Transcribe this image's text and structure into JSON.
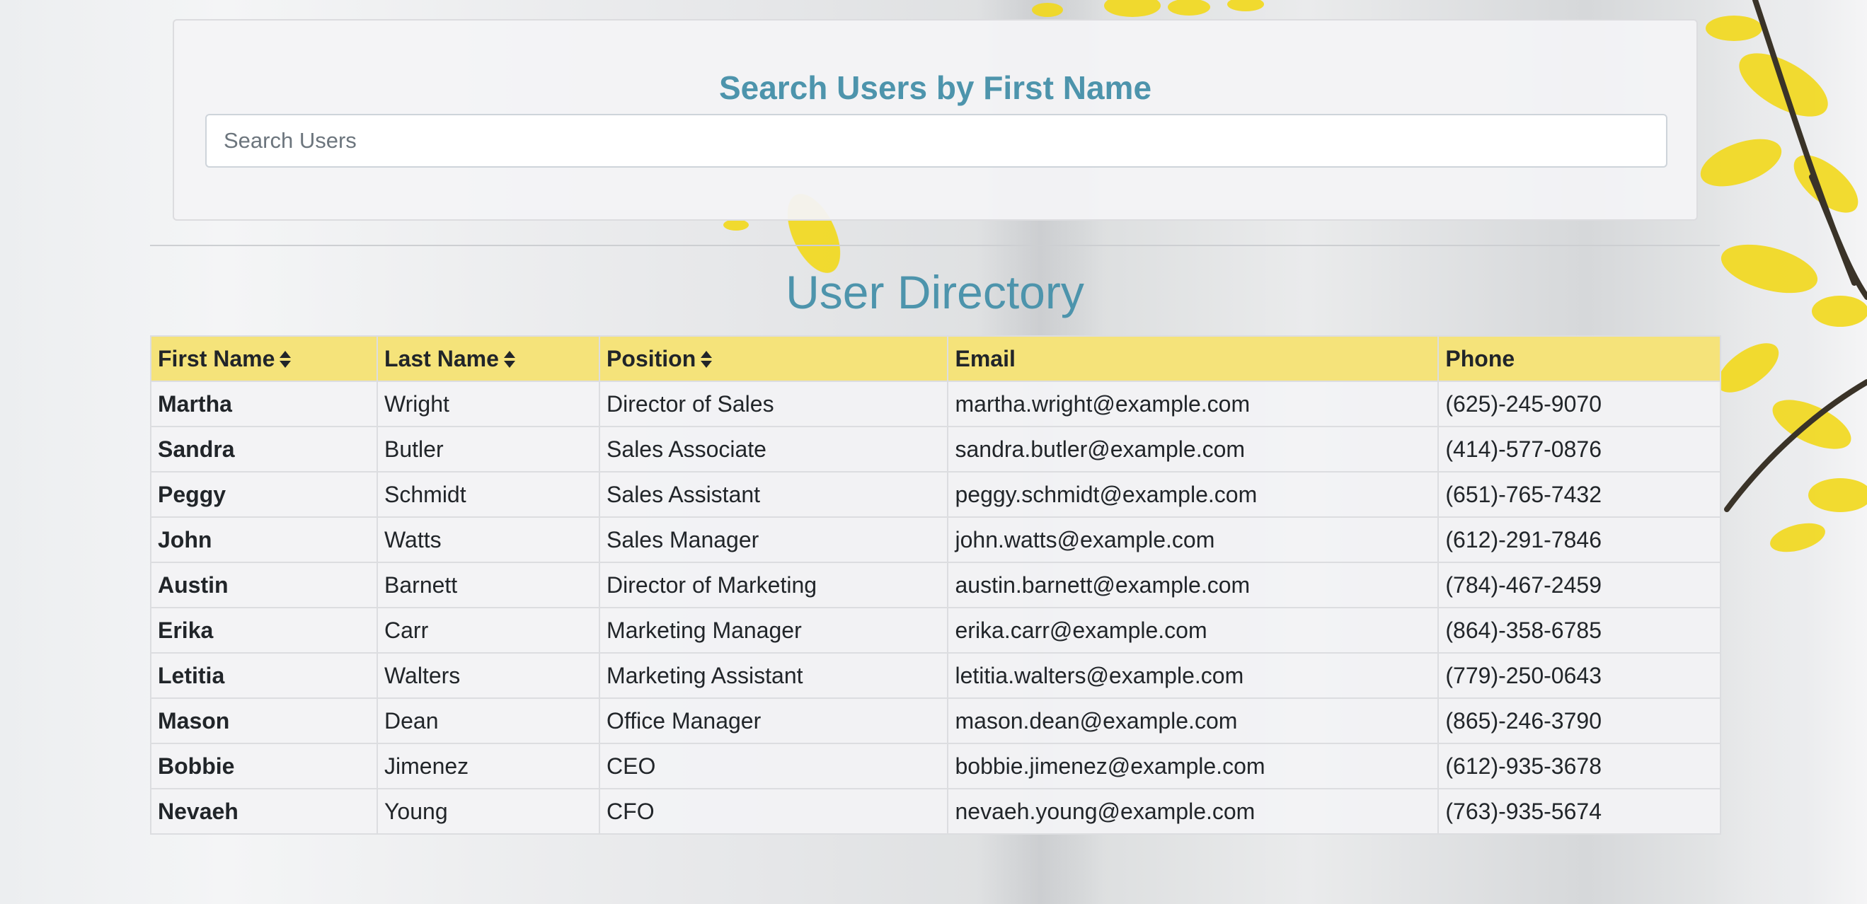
{
  "search": {
    "title": "Search Users by First Name",
    "placeholder": "Search Users",
    "value": ""
  },
  "directory": {
    "title": "User Directory",
    "columns": [
      {
        "label": "First Name",
        "sortable": true
      },
      {
        "label": "Last Name",
        "sortable": true
      },
      {
        "label": "Position",
        "sortable": true
      },
      {
        "label": "Email",
        "sortable": false
      },
      {
        "label": "Phone",
        "sortable": false
      }
    ],
    "rows": [
      {
        "first": "Martha",
        "last": "Wright",
        "position": "Director of Sales",
        "email": "martha.wright@example.com",
        "phone": "(625)-245-9070"
      },
      {
        "first": "Sandra",
        "last": "Butler",
        "position": "Sales Associate",
        "email": "sandra.butler@example.com",
        "phone": "(414)-577-0876"
      },
      {
        "first": "Peggy",
        "last": "Schmidt",
        "position": "Sales Assistant",
        "email": "peggy.schmidt@example.com",
        "phone": "(651)-765-7432"
      },
      {
        "first": "John",
        "last": "Watts",
        "position": "Sales Manager",
        "email": "john.watts@example.com",
        "phone": "(612)-291-7846"
      },
      {
        "first": "Austin",
        "last": "Barnett",
        "position": "Director of Marketing",
        "email": "austin.barnett@example.com",
        "phone": "(784)-467-2459"
      },
      {
        "first": "Erika",
        "last": "Carr",
        "position": "Marketing Manager",
        "email": "erika.carr@example.com",
        "phone": "(864)-358-6785"
      },
      {
        "first": "Letitia",
        "last": "Walters",
        "position": "Marketing Assistant",
        "email": "letitia.walters@example.com",
        "phone": "(779)-250-0643"
      },
      {
        "first": "Mason",
        "last": "Dean",
        "position": "Office Manager",
        "email": "mason.dean@example.com",
        "phone": "(865)-246-3790"
      },
      {
        "first": "Bobbie",
        "last": "Jimenez",
        "position": "CEO",
        "email": "bobbie.jimenez@example.com",
        "phone": "(612)-935-3678"
      },
      {
        "first": "Nevaeh",
        "last": "Young",
        "position": "CFO",
        "email": "nevaeh.young@example.com",
        "phone": "(763)-935-5674"
      }
    ]
  },
  "icons": {
    "sort": "sort-icon",
    "background": "forsythia-flowers-photo"
  },
  "colors": {
    "heading": "#4d94ac",
    "table_header": "#f5e37a",
    "flower": "#f2d81a"
  }
}
